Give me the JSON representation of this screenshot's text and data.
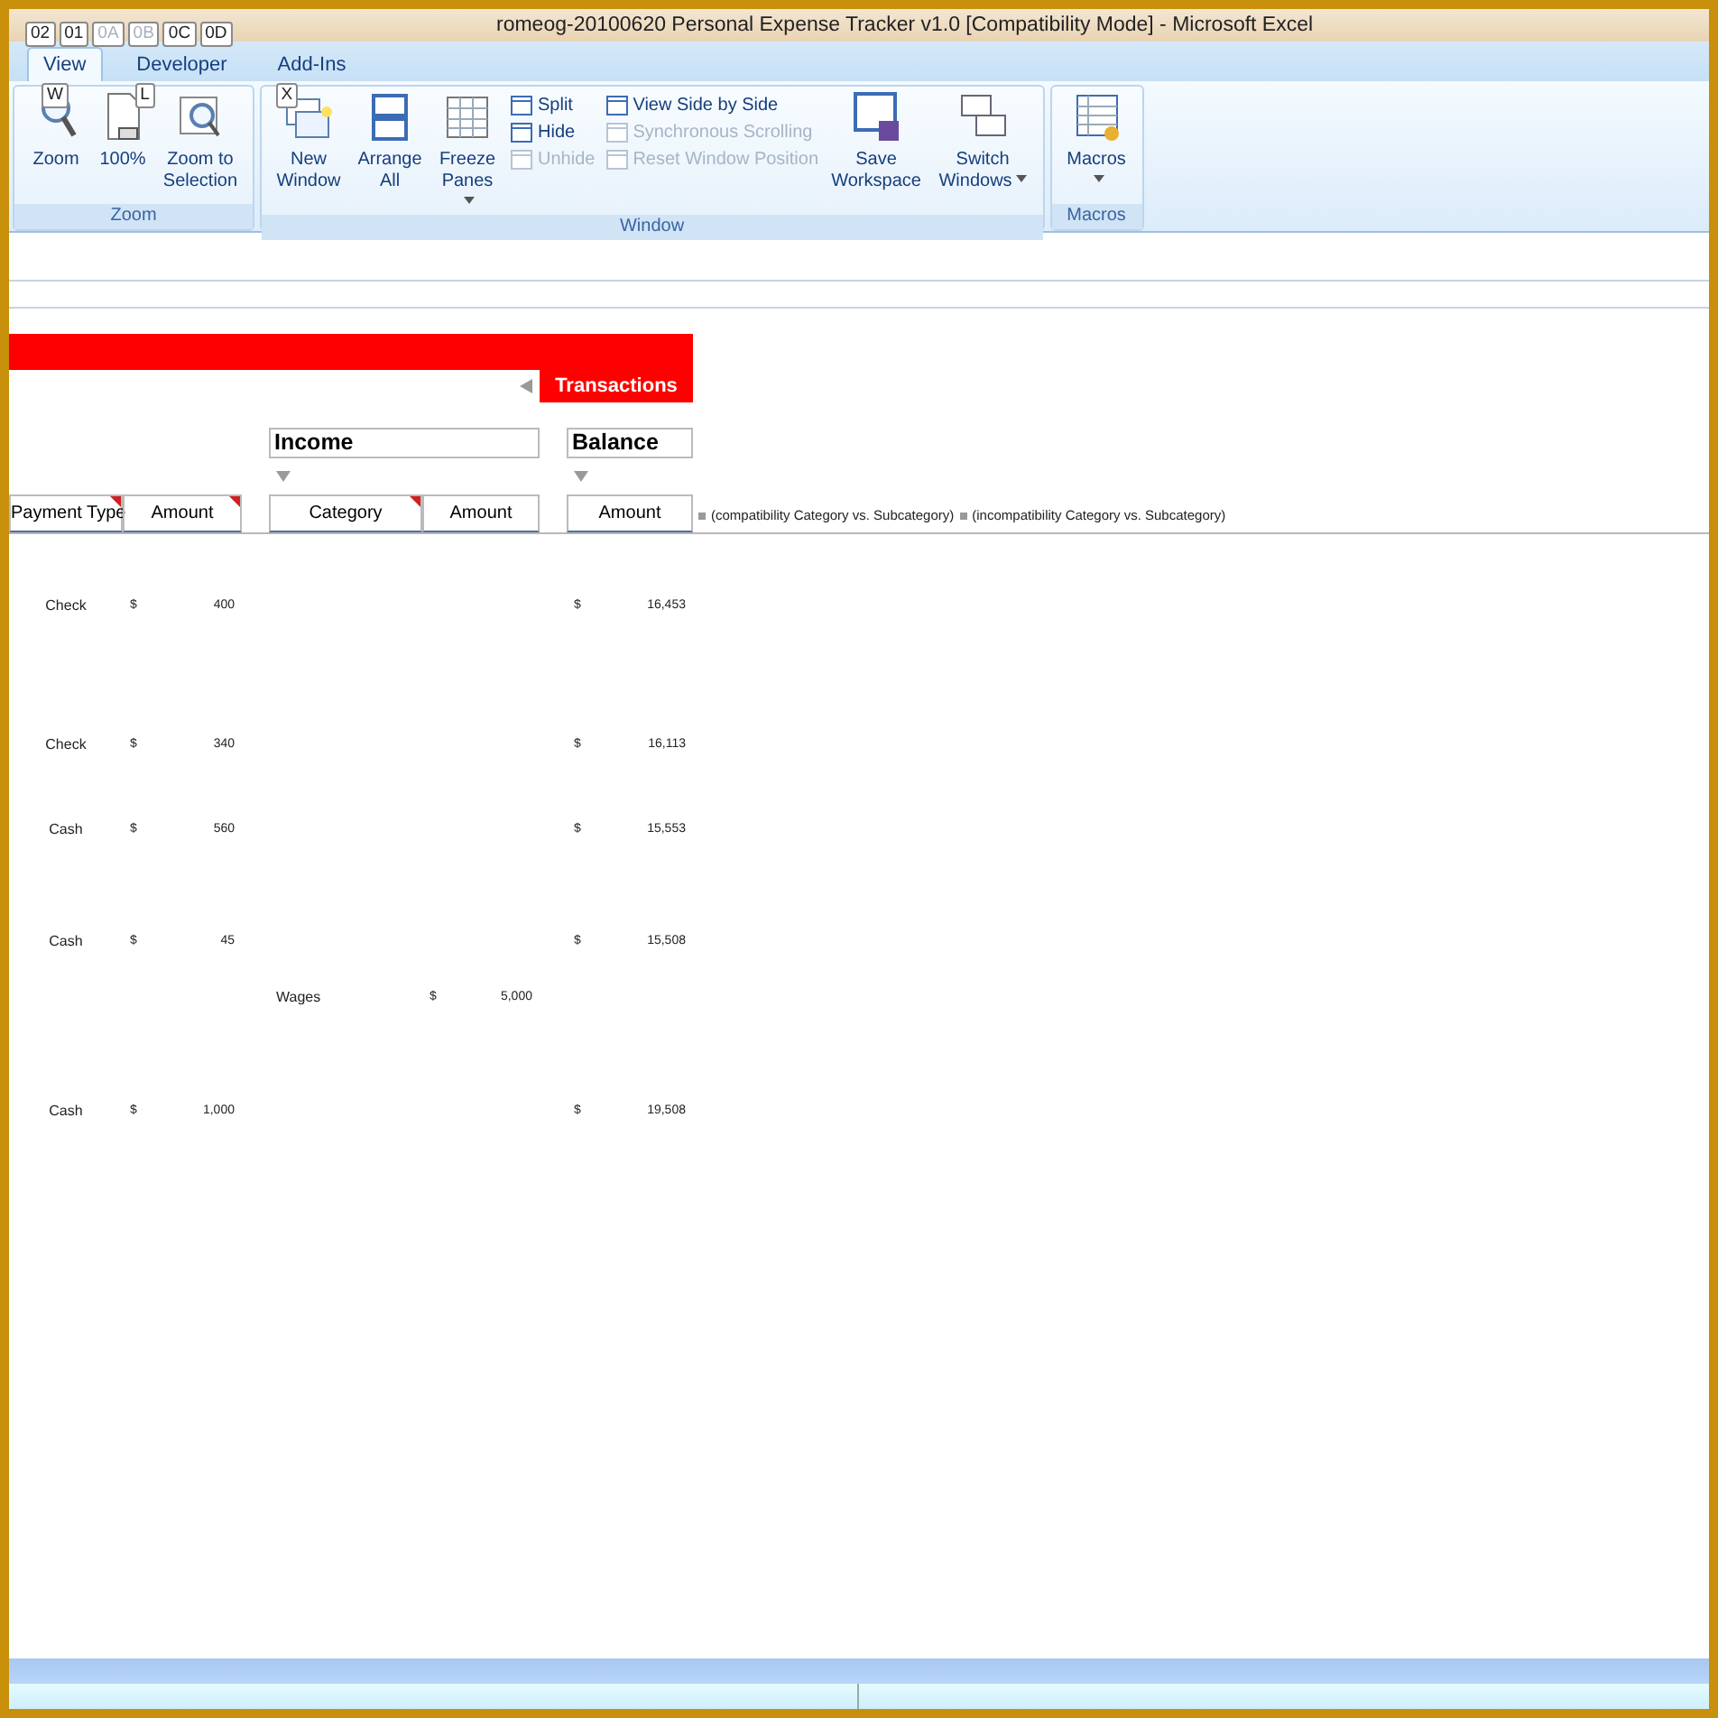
{
  "window": {
    "title": "romeog-20100620 Personal Expense Tracker v1.0  [Compatibility Mode] - Microsoft Excel"
  },
  "quick_access_keytips": [
    {
      "label": "02",
      "disabled": false
    },
    {
      "label": "01",
      "disabled": false
    },
    {
      "label": "0A",
      "disabled": true
    },
    {
      "label": "0B",
      "disabled": true
    },
    {
      "label": "0C",
      "disabled": false
    },
    {
      "label": "0D",
      "disabled": false
    }
  ],
  "tabs": [
    {
      "label": "View",
      "selected": true,
      "keytip": "W"
    },
    {
      "label": "Developer",
      "selected": false,
      "keytip": "L"
    },
    {
      "label": "Add-Ins",
      "selected": false,
      "keytip": "X"
    }
  ],
  "ribbon_groups": [
    {
      "label": "Zoom",
      "items": [
        {
          "kind": "large",
          "label": "Zoom",
          "dropdown": false
        },
        {
          "kind": "large",
          "label": "100%",
          "dropdown": false
        },
        {
          "kind": "large",
          "label": "Zoom to Selection",
          "dropdown": false
        }
      ]
    },
    {
      "label": "Window",
      "items": [
        {
          "kind": "large",
          "label": "New Window",
          "dropdown": false
        },
        {
          "kind": "large",
          "label": "Arrange All",
          "dropdown": false
        },
        {
          "kind": "large",
          "label": "Freeze Panes",
          "dropdown": true
        },
        {
          "kind": "small",
          "label": "Split",
          "disabled": false
        },
        {
          "kind": "small",
          "label": "Hide",
          "disabled": false
        },
        {
          "kind": "small",
          "label": "Unhide",
          "disabled": true
        },
        {
          "kind": "small",
          "label": "View Side by Side",
          "disabled": false
        },
        {
          "kind": "small",
          "label": "Synchronous Scrolling",
          "disabled": true
        },
        {
          "kind": "small",
          "label": "Reset Window Position",
          "disabled": true
        },
        {
          "kind": "large",
          "label": "Save Workspace",
          "dropdown": false
        },
        {
          "kind": "large",
          "label": "Switch Windows",
          "dropdown": true
        }
      ]
    },
    {
      "label": "Macros",
      "items": [
        {
          "kind": "large",
          "label": "Macros",
          "dropdown": true
        }
      ]
    }
  ],
  "sheet": {
    "banner": "Transactions",
    "sections": [
      "Income",
      "Balance"
    ],
    "columns": [
      {
        "label": "Payment Type",
        "comment": true
      },
      {
        "label": "Amount",
        "comment": true
      },
      {
        "label": "Category",
        "comment": true
      },
      {
        "label": "Amount",
        "comment": false
      },
      {
        "label": "Amount",
        "comment": false
      }
    ],
    "notes": [
      "(compatibility Category vs. Subcategory)",
      "(incompatibility Category vs. Subcategory)"
    ],
    "rows": [
      {
        "payment_type": "Check",
        "amount_currency": "$",
        "amount": "400",
        "balance_currency": "$",
        "balance": "16,453"
      },
      {
        "payment_type": "Check",
        "amount_currency": "$",
        "amount": "340",
        "balance_currency": "$",
        "balance": "16,113"
      },
      {
        "payment_type": "Cash",
        "amount_currency": "$",
        "amount": "560",
        "balance_currency": "$",
        "balance": "15,553"
      },
      {
        "payment_type": "Cash",
        "amount_currency": "$",
        "amount": "45",
        "balance_currency": "$",
        "balance": "15,508"
      },
      {
        "income_category": "Wages",
        "income_currency": "$",
        "income_amount": "5,000"
      },
      {
        "payment_type": "Cash",
        "amount_currency": "$",
        "amount": "1,000",
        "balance_currency": "$",
        "balance": "19,508"
      }
    ]
  }
}
